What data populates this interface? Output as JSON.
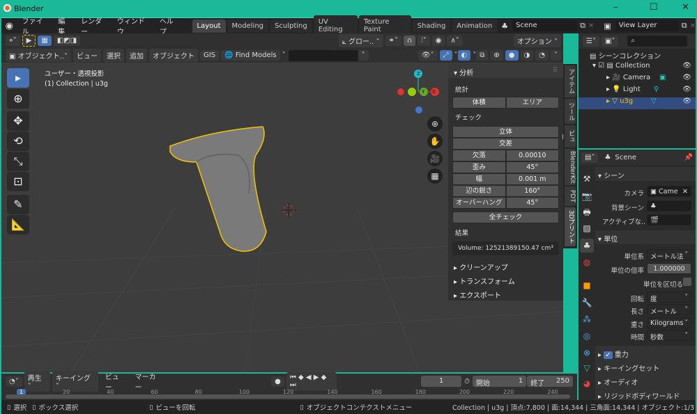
{
  "window": {
    "title": "Blender",
    "min": "–",
    "max": "☐",
    "close": "✕",
    "border_color": "#1ab99a"
  },
  "topbar": {
    "menus": [
      "ファイル",
      "編集",
      "レンダー",
      "ウィンドウ",
      "ヘルプ"
    ],
    "tabs": [
      "Layout",
      "Modeling",
      "Sculpting",
      "UV Editing",
      "Texture Paint",
      "Shading",
      "Animation"
    ],
    "active_tab": "Layout",
    "scene": "Scene",
    "view_layer": "View Layer"
  },
  "tool_header": {
    "orientation": "グロー..",
    "options": "オプション"
  },
  "view_header": {
    "mode": "オブジェクト..",
    "menus": [
      "ビュー",
      "選択",
      "追加",
      "オブジェクト",
      "GIS"
    ],
    "find_models": "Find Models",
    "search_value": ""
  },
  "viewport": {
    "view_name": "ユーザー・透視投影",
    "collection_info": "(1) Collection | u3g",
    "accent": "#4772b3",
    "selection_color": "#f5c400",
    "gizmo": {
      "z": "Z",
      "x": "X",
      "y": "Y"
    }
  },
  "npanel": {
    "analysis": "分析",
    "statistics": "統計",
    "volume_btn": "体積",
    "area_btn": "エリア",
    "check": "チェック",
    "solid": "立体",
    "intersect": "交差",
    "params": [
      {
        "label": "欠落",
        "value": "0.00010"
      },
      {
        "label": "歪み",
        "value": "45°"
      },
      {
        "label": "幅",
        "value": "0.001 m"
      },
      {
        "label": "辺の鋭さ",
        "value": "160°"
      },
      {
        "label": "オーバーハング",
        "value": "45°"
      }
    ],
    "check_all": "全チェック",
    "result": "結果",
    "result_value": "Volume: 12521389150.47 cm³",
    "collapsed": [
      "クリーンアップ",
      "トランスフォーム",
      "エクスポート"
    ],
    "tabs": [
      "アイテム",
      "ツール",
      "ビュー",
      "BlenderKit",
      "PDT",
      "3Dプリント"
    ],
    "active_tab": "3Dプリント"
  },
  "outliner": {
    "root": "シーンコレクション",
    "items": [
      {
        "name": "Collection"
      },
      {
        "name": "Camera"
      },
      {
        "name": "Light"
      },
      {
        "name": "u3g",
        "selected": true
      }
    ]
  },
  "properties": {
    "scene": "Scene",
    "scene_section": "シーン",
    "camera_label": "カメラ",
    "camera_value": "Came",
    "bg_scene_label": "背景シーン",
    "active_clip_label": "アクティブな..",
    "units_section": "単位",
    "unit_system_label": "単位系",
    "unit_system": "メートル法",
    "unit_scale_label": "単位の倍率",
    "unit_scale": "1.000000",
    "separate_units": "単位を区切る",
    "separate_units_checked": false,
    "rotation_label": "回転",
    "rotation": "度",
    "length_label": "長さ",
    "length": "メートル",
    "mass_label": "重さ",
    "mass": "Kilograms",
    "time_label": "時間",
    "time": "秒数",
    "gravity": "重力",
    "gravity_checked": true,
    "keying_sets": "キーイングセット",
    "audio": "オーディオ",
    "rigid_body": "リジッドボディワールド"
  },
  "timeline": {
    "menus": [
      "再生",
      "キーイング",
      "ビュー",
      "マーカー"
    ],
    "current_frame": "1",
    "start_label": "開始",
    "start": "1",
    "end_label": "終了",
    "end": "250",
    "ticks": [
      "20",
      "40",
      "60",
      "80",
      "100",
      "120",
      "140",
      "160",
      "180",
      "200",
      "220",
      "240"
    ],
    "playhead": "1"
  },
  "status": {
    "select": "選択",
    "box_select": "ボックス選択",
    "rotate_view": "ビューを回転",
    "context_menu": "オブジェクトコンテクストメニュー",
    "stats": "Collection | u3g | 頂点:7,800 | 面:14,344 | 三角面:14,344 | オブジェクト:1/3"
  }
}
